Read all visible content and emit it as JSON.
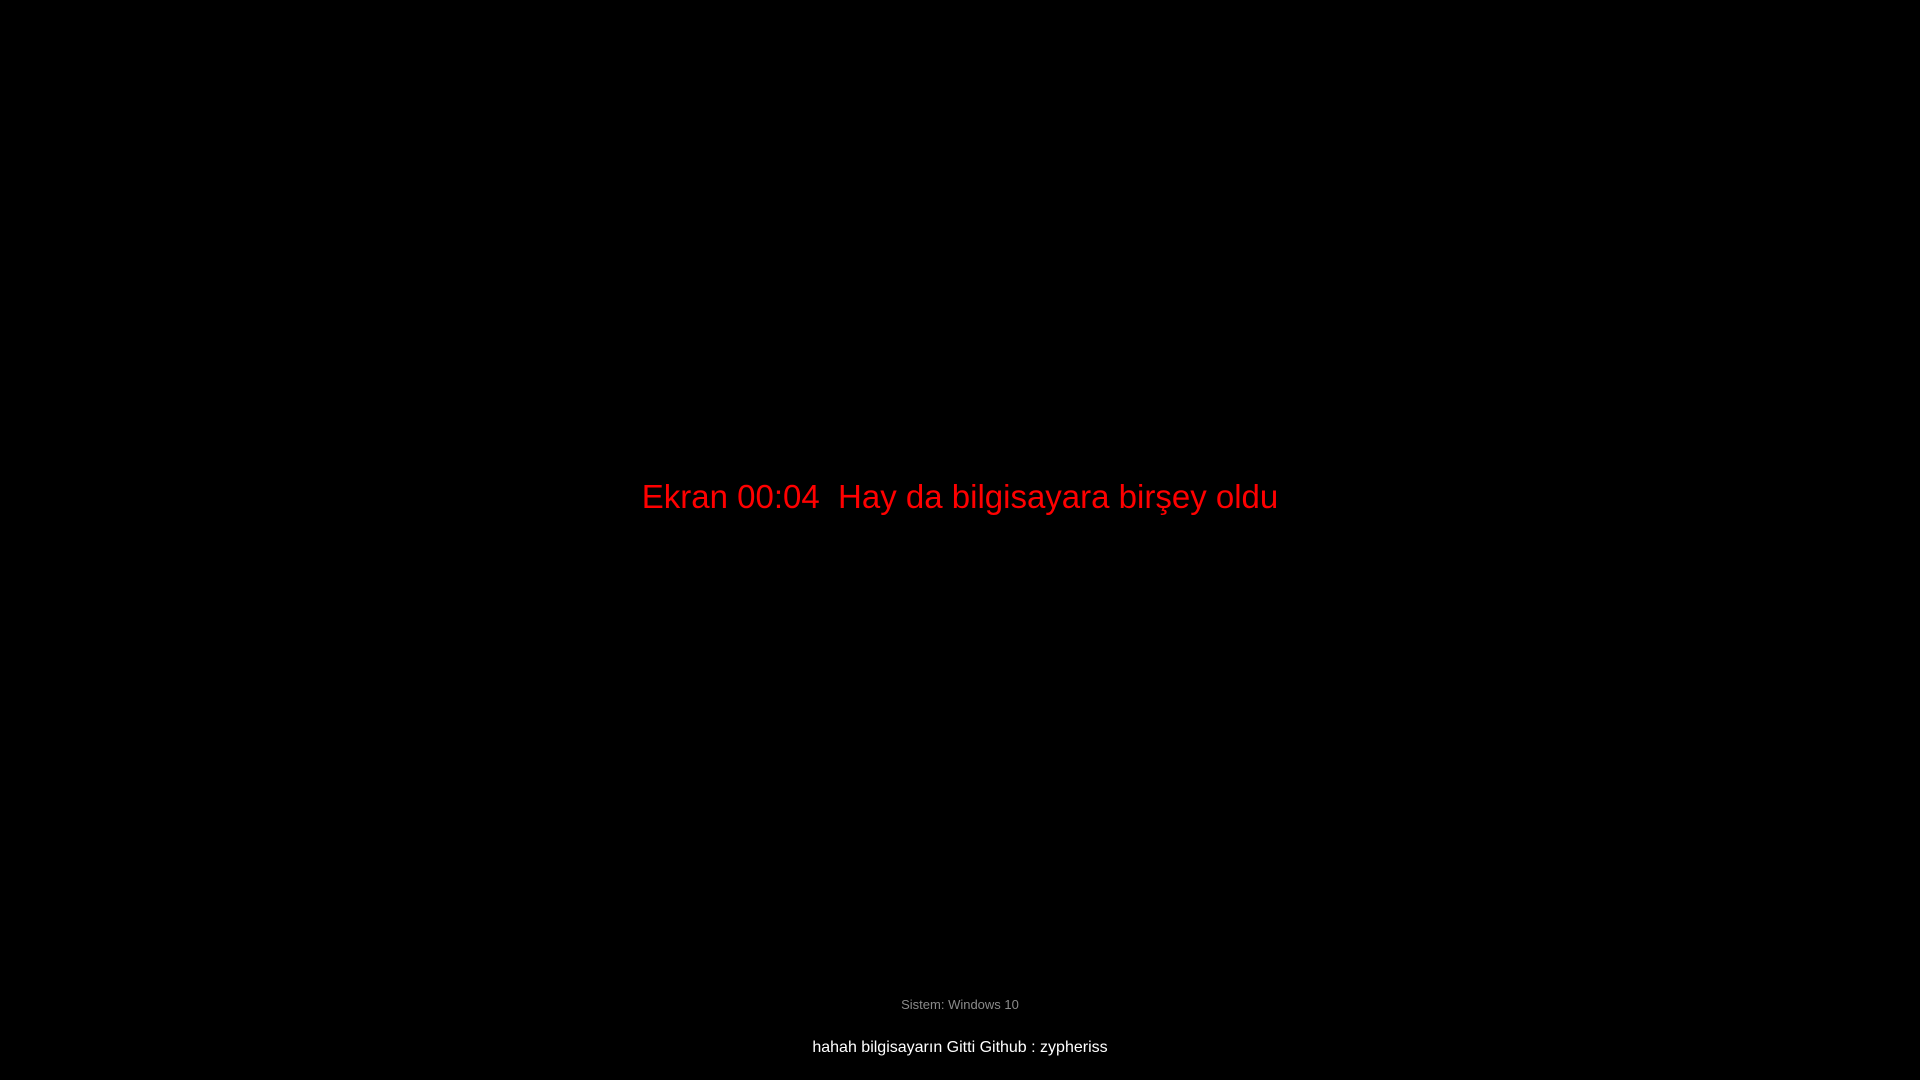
{
  "screen": {
    "background_color": "#000000",
    "main_message": "Ekran 00:04  Hay da bilgisayara birşey oldu",
    "main_message_color": "#ff0000",
    "system_info": "Sistem: Windows 10",
    "system_info_color": "#8a8a8a",
    "footer_text": "hahah bilgisayarın Gitti Github : zypheriss",
    "footer_text_color": "#ffffff"
  }
}
